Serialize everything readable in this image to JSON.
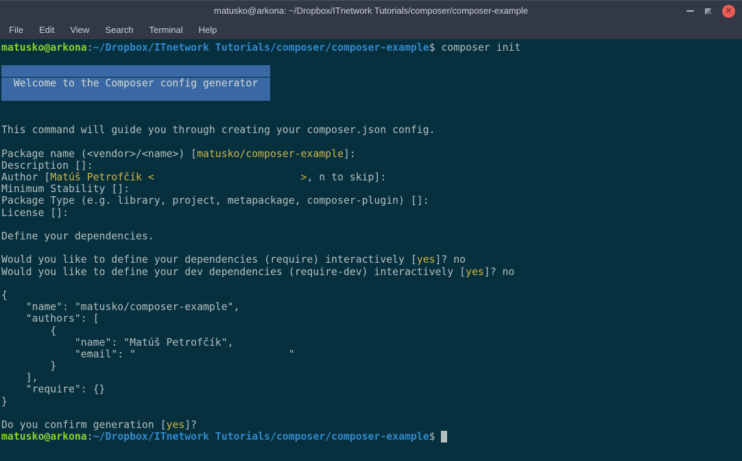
{
  "window": {
    "title": "matusko@arkona: ~/Dropbox/ITnetwork Tutorials/composer/composer-example",
    "controls": [
      "minimize-icon",
      "restore-icon",
      "close-icon"
    ],
    "close_glyph": "✕"
  },
  "menu": {
    "items": [
      "File",
      "Edit",
      "View",
      "Search",
      "Terminal",
      "Help"
    ]
  },
  "colors": {
    "titlebar_bg": "#323845",
    "terminal_bg": "#06303e",
    "foreground": "#b4c0c0",
    "prompt_green": "#8ed22f",
    "path_blue": "#3489cb",
    "highlight_yellow": "#d2b545",
    "banner_bg": "#3a68a5",
    "close_button_red": "#ea5b52"
  },
  "terminal": {
    "lines": [
      [
        {
          "s": "green",
          "t": "matusko@arkona"
        },
        {
          "s": "fg",
          "t": ":"
        },
        {
          "s": "blue",
          "t": "~/Dropbox/ITnetwork Tutorials/composer/composer-example"
        },
        {
          "s": "fg",
          "t": "$ composer init"
        }
      ],
      [],
      [
        {
          "s": "banner",
          "t": "                                            "
        }
      ],
      [
        {
          "s": "banner",
          "t": "  Welcome to the Composer config generator  "
        }
      ],
      [
        {
          "s": "banner",
          "t": "                                            "
        }
      ],
      [],
      [],
      [
        {
          "s": "fg",
          "t": "This command will guide you through creating your composer.json config."
        }
      ],
      [],
      [
        {
          "s": "fg",
          "t": "Package name (<vendor>/<name>) ["
        },
        {
          "s": "yellow",
          "t": "matusko/composer-example"
        },
        {
          "s": "fg",
          "t": "]:"
        }
      ],
      [
        {
          "s": "fg",
          "t": "Description []:"
        }
      ],
      [
        {
          "s": "fg",
          "t": "Author ["
        },
        {
          "s": "yellow",
          "t": "Matúš Petrofčík <                        >"
        },
        {
          "s": "fg",
          "t": ", n to skip]:"
        }
      ],
      [
        {
          "s": "fg",
          "t": "Minimum Stability []:"
        }
      ],
      [
        {
          "s": "fg",
          "t": "Package Type (e.g. library, project, metapackage, composer-plugin) []:"
        }
      ],
      [
        {
          "s": "fg",
          "t": "License []:"
        }
      ],
      [],
      [
        {
          "s": "fg",
          "t": "Define your dependencies."
        }
      ],
      [],
      [
        {
          "s": "fg",
          "t": "Would you like to define your dependencies (require) interactively ["
        },
        {
          "s": "yellow",
          "t": "yes"
        },
        {
          "s": "fg",
          "t": "]? no"
        }
      ],
      [
        {
          "s": "fg",
          "t": "Would you like to define your dev dependencies (require-dev) interactively ["
        },
        {
          "s": "yellow",
          "t": "yes"
        },
        {
          "s": "fg",
          "t": "]? no"
        }
      ],
      [],
      [
        {
          "s": "fg",
          "t": "{"
        }
      ],
      [
        {
          "s": "fg",
          "t": "    \"name\": \"matusko/composer-example\","
        }
      ],
      [
        {
          "s": "fg",
          "t": "    \"authors\": ["
        }
      ],
      [
        {
          "s": "fg",
          "t": "        {"
        }
      ],
      [
        {
          "s": "fg",
          "t": "            \"name\": \"Matúš Petrofčík\","
        }
      ],
      [
        {
          "s": "fg",
          "t": "            \"email\": \"                         \""
        }
      ],
      [
        {
          "s": "fg",
          "t": "        }"
        }
      ],
      [
        {
          "s": "fg",
          "t": "    ],"
        }
      ],
      [
        {
          "s": "fg",
          "t": "    \"require\": {}"
        }
      ],
      [
        {
          "s": "fg",
          "t": "}"
        }
      ],
      [],
      [
        {
          "s": "fg",
          "t": "Do you confirm generation ["
        },
        {
          "s": "yellow",
          "t": "yes"
        },
        {
          "s": "fg",
          "t": "]?"
        }
      ],
      [
        {
          "s": "green",
          "t": "matusko@arkona"
        },
        {
          "s": "fg",
          "t": ":"
        },
        {
          "s": "blue",
          "t": "~/Dropbox/ITnetwork Tutorials/composer/composer-example"
        },
        {
          "s": "fg",
          "t": "$ "
        },
        {
          "s": "cursor",
          "t": " "
        }
      ]
    ]
  }
}
